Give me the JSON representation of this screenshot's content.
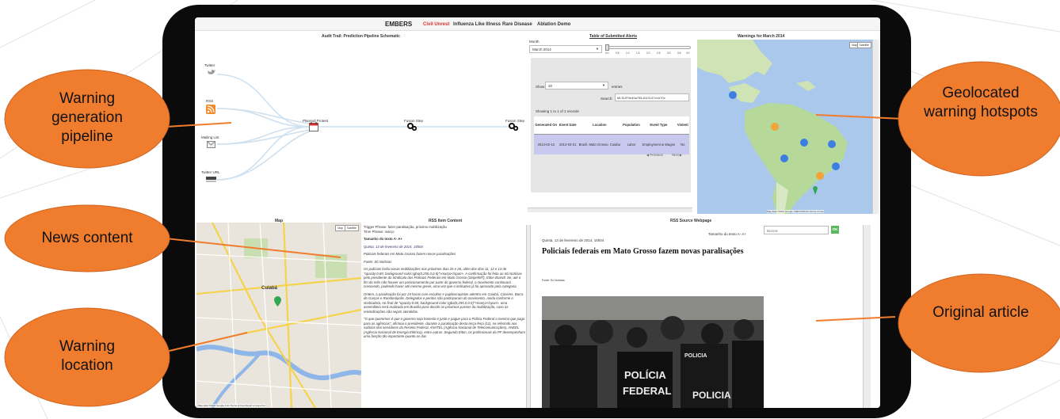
{
  "navbar": {
    "brand": "EMBERS",
    "links": [
      "Civil Unrest",
      "Influenza Like Illness",
      "Rare Disease",
      "Ablation Demo"
    ]
  },
  "pipeline": {
    "title": "Audit Trail: Prediction Pipeline Schematic",
    "sources": [
      "Twitter",
      "RSS",
      "Mailing List",
      "Twitter URL"
    ],
    "nodes": [
      "Planned Protest",
      "Fusion Step",
      "Fusion Step"
    ]
  },
  "alerts": {
    "title": "Table of Submitted Alerts",
    "month_label": "Month",
    "month_value": "March 2014",
    "slider_ticks": [
      "0.0",
      "0.5",
      "1.0",
      "1.5",
      "2.0",
      "2.5",
      "3.0",
      "3.5",
      "4.0"
    ],
    "show_label": "Show",
    "show_value": "20",
    "entries_label": "entries",
    "search_label": "Search:",
    "search_value": "MLSUP4e40a755-6103-57cf-b70v",
    "showing_text": "Showing 1 to 1 of 1 records",
    "columns": [
      "Generated On",
      "Event Date",
      "Location",
      "Population",
      "Event Type",
      "Violent"
    ],
    "rows": [
      [
        "2014-02-13",
        "2014-03-01",
        "Brazil, Mato Grosso, Cuiaba",
        "Labor",
        "Employment & Wages",
        "No"
      ]
    ],
    "prev_label": "◀ Previous",
    "next_label": "Next ▶"
  },
  "warnings_map": {
    "title": "Warnings for March 2014",
    "map_btn": "Map",
    "sat_btn": "Satellite",
    "footer": "Map data ©2014 Google, INEGI  500 km  Terms of Use"
  },
  "city_map": {
    "title": "Map",
    "map_btn": "Map",
    "sat_btn": "Satellite",
    "footer": "Map data ©2014 Google  1 km  Terms of Use  Report a map error",
    "city_label": "Cuiabá"
  },
  "rss": {
    "title": "RSS Item Content",
    "trigger": "Trigger Phrase: fazer paralisação, próximo mobilização",
    "time_phrase": "Time Phrase: março",
    "font_size": "Tamanho do texto A- A+",
    "date": "Quinta, 13 de fevereiro de 2014, 15h04",
    "headline": "Policiais federais em Mato Grosso fazem novas paralisações",
    "source": "Fonte: Só Notícias",
    "p1": "Os policiais farão novas mobilizações nos próximos dias 25 e 26, além dos dias 11, 12 e 13 de \"opacity:0.65; background-color:rgba(0,255,0,0.5)\">março</span>. A confirmação foi feita ao Só Notícias pelo presidente do Sindicato dos Policiais Federais em Mato Grosso (SinpefMT), Elton Brandt. Se, até o fim do mês não houver um posicionamento por parte do governo federal, o movimento continuará crescendo, podendo haver até mesmo greve, uma vez que o indicativo já foi aprovado pela categoria.",
    "p2": "Ontem, a paralisação foi por 24 horas com escoltas e papiloscopistas adentro em Cuiabá, Cáceres, Barra do Garças e Rondonópolis. Delegados e peritos não participaram do movimento. Ainda conforme o sindicalista, no final de \"opacity:0.65; background-color:rgba(0,255,0,0.5)\">março</span>, uma assembleia será realizada em Brasília para decidir os próximos passos da mobilização, caso as reivindicações não sejam atendidas.",
    "p3": "\"O que queremos é que o governo seja honesto e justo e pague para a Polícia Federal o mesmo que paga para as agências\", afirmou o presidente, durante a paralisação desta terça-feira (11), se referindo aos salários dos servidores da Receita Federal, ANATEL (Agência Nacional de Telecomunicações), ANEEL (Agência Nacional de Energia Elétrica), entre outras. Segundo Elton, os profissionais da PF desempenham uma função tão importante quanto os das"
  },
  "webpage": {
    "title": "RSS Source Webpage",
    "date": "Quinta, 13 de fevereiro de 2014, 15h04",
    "font_size": "Tamanho do texto A- A+",
    "headline": "Policiais federais em Mato Grosso fazem novas paralisações",
    "source": "Fonte: Só Notícias",
    "search_placeholder": "Buscar",
    "ok_label": "OK",
    "photo_caption_1": "POLICIA",
    "photo_caption_2": "POLÍCIA",
    "photo_caption_3": "FEDERAL",
    "photo_caption_4": "POLICIA"
  },
  "callouts": {
    "pipeline": "Warning generation pipeline",
    "news": "News content",
    "location": "Warning location",
    "hotspots": "Geolocated warning hotspots",
    "article": "Original article"
  },
  "colors": {
    "callout_fill": "#f07d2e",
    "nav_active": "#d9302c",
    "table_row": "#c9c9ef",
    "ok_green": "#5cb85c"
  }
}
